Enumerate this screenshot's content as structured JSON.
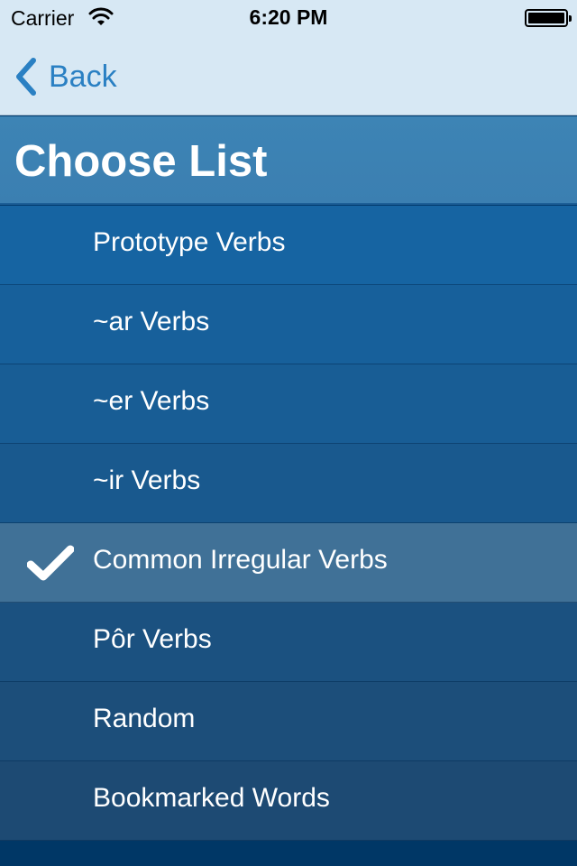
{
  "status_bar": {
    "carrier": "Carrier",
    "time": "6:20 PM",
    "icons": [
      "wifi-icon",
      "battery-icon"
    ]
  },
  "nav_bar": {
    "back_label": "Back",
    "back_icon": "chevron-left-icon"
  },
  "header": {
    "title": "Choose List"
  },
  "list": {
    "items": [
      {
        "label": "Prototype Verbs",
        "selected": false
      },
      {
        "label": "~ar Verbs",
        "selected": false
      },
      {
        "label": "~er Verbs",
        "selected": false
      },
      {
        "label": "~ir Verbs",
        "selected": false
      },
      {
        "label": "Common Irregular Verbs",
        "selected": true
      },
      {
        "label": "Pôr Verbs",
        "selected": false
      },
      {
        "label": "Random",
        "selected": false
      },
      {
        "label": "Bookmarked Words",
        "selected": false
      }
    ],
    "selected_icon": "checkmark-icon"
  },
  "colors": {
    "accent": "#2a80c3",
    "header_background": "#3d84b5",
    "list_gradient_top": "#1664a2",
    "list_gradient_bottom": "#1d4a73",
    "selected_row": "#407197",
    "text": "#ffffff"
  }
}
